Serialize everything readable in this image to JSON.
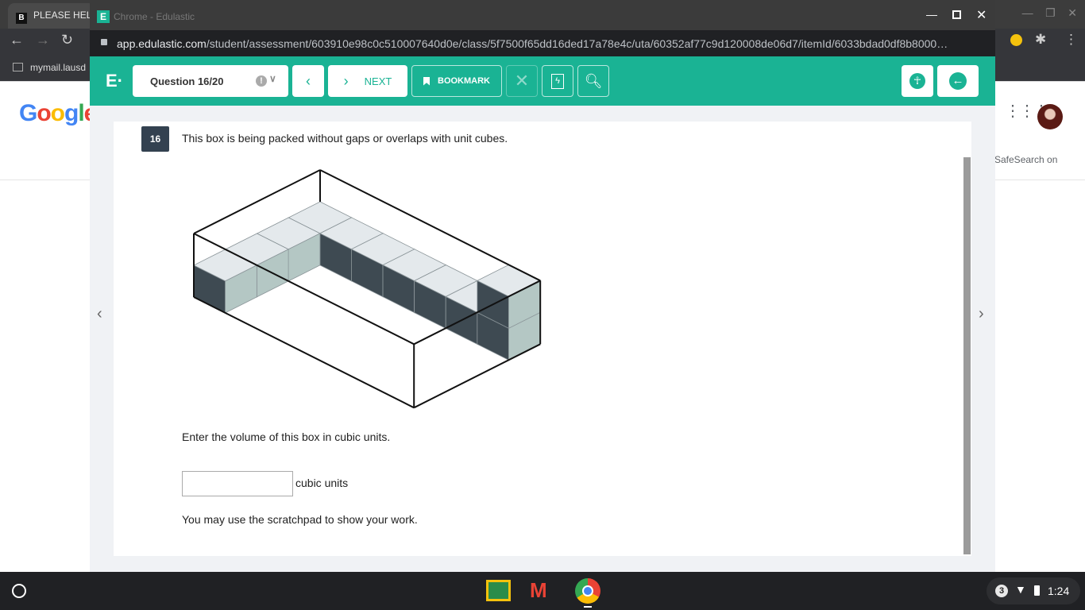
{
  "background_browser": {
    "tab_title": "PLEASE HEL",
    "tab_favicon": "B",
    "bookmark": "mymail.lausd",
    "google_logo": "Google",
    "safesearch": "SafeSearch on"
  },
  "window": {
    "title": "Chrome - Edulastic",
    "url_host": "app.edulastic.com",
    "url_path": "/student/assessment/603910e98c0c510007640d0e/class/5f7500f65dd16ded17a78e4c/uta/60352af77c9d120008de06d7/itemId/6033bdad0df8b8000…"
  },
  "toolbar": {
    "logo": "E·",
    "question_select": "Question 16/20",
    "next_label": "NEXT",
    "bookmark_label": "BOOKMARK"
  },
  "question": {
    "number": "16",
    "prompt": "This box is being packed without gaps or overlaps with unit cubes.",
    "instruction": "Enter the volume of this box in cubic units.",
    "answer_value": "",
    "unit_label": "cubic units",
    "note": "You may use the scratchpad to show your work."
  },
  "taskbar": {
    "notification_count": "3",
    "time": "1:24"
  },
  "colors": {
    "accent": "#1ab394",
    "cube_top": "#e4e9ec",
    "cube_front": "#3e4a52",
    "cube_side": "#b4c7c4"
  }
}
